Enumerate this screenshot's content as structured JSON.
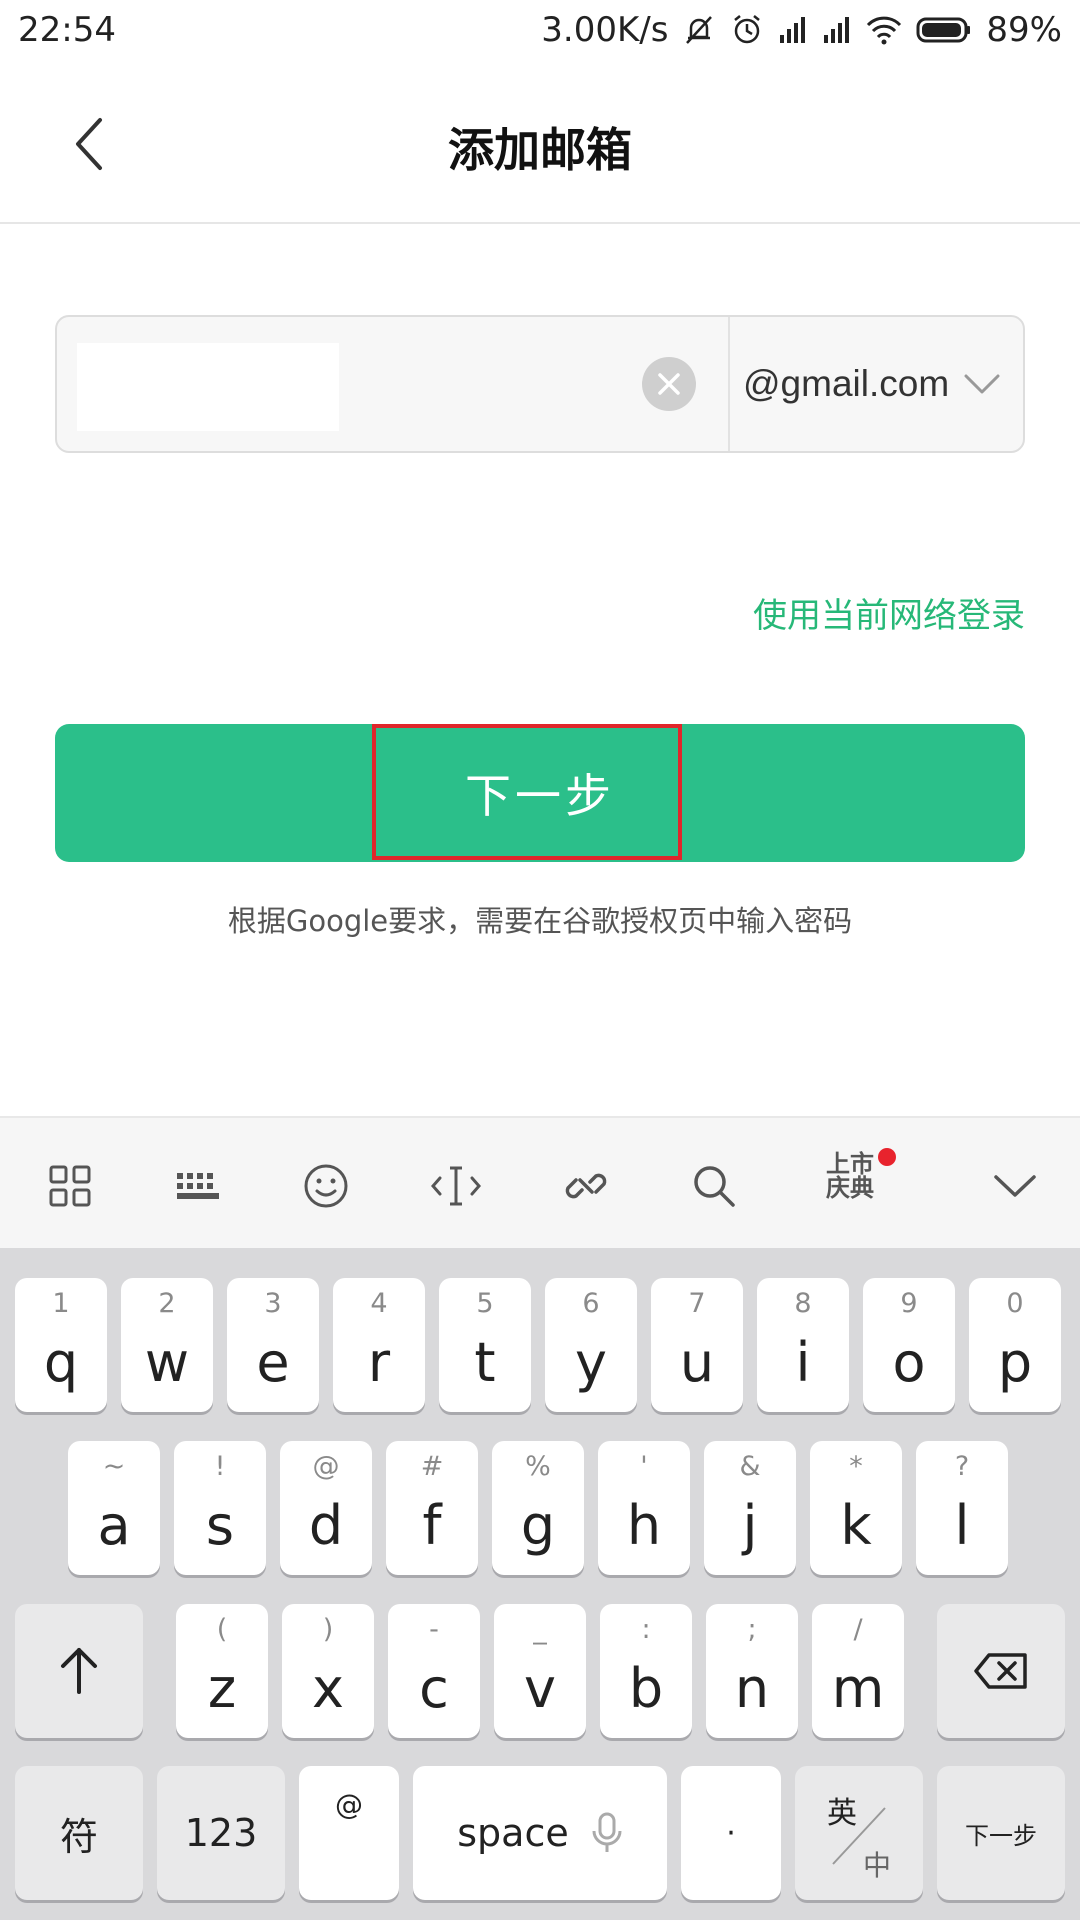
{
  "status": {
    "time": "22:54",
    "net_speed": "3.00K/s",
    "battery": "89%"
  },
  "header": {
    "title": "添加邮箱"
  },
  "email": {
    "value": "",
    "domain": "@gmail.com"
  },
  "links": {
    "network_login": "使用当前网络登录"
  },
  "primary_button": {
    "label": "下一步"
  },
  "hint_text": "根据Google要求，需要在谷歌授权页中输入密码",
  "keyboard": {
    "event_badge": "上市\n庆典",
    "row1": [
      {
        "hint": "1",
        "char": "q"
      },
      {
        "hint": "2",
        "char": "w"
      },
      {
        "hint": "3",
        "char": "e"
      },
      {
        "hint": "4",
        "char": "r"
      },
      {
        "hint": "5",
        "char": "t"
      },
      {
        "hint": "6",
        "char": "y"
      },
      {
        "hint": "7",
        "char": "u"
      },
      {
        "hint": "8",
        "char": "i"
      },
      {
        "hint": "9",
        "char": "o"
      },
      {
        "hint": "0",
        "char": "p"
      }
    ],
    "row2": [
      {
        "hint": "~",
        "char": "a"
      },
      {
        "hint": "!",
        "char": "s"
      },
      {
        "hint": "@",
        "char": "d"
      },
      {
        "hint": "#",
        "char": "f"
      },
      {
        "hint": "%",
        "char": "g"
      },
      {
        "hint": "'",
        "char": "h"
      },
      {
        "hint": "&",
        "char": "j"
      },
      {
        "hint": "*",
        "char": "k"
      },
      {
        "hint": "?",
        "char": "l"
      }
    ],
    "row3": [
      {
        "hint": "(",
        "char": "z"
      },
      {
        "hint": ")",
        "char": "x"
      },
      {
        "hint": "-",
        "char": "c"
      },
      {
        "hint": "_",
        "char": "v"
      },
      {
        "hint": ":",
        "char": "b"
      },
      {
        "hint": ";",
        "char": "n"
      },
      {
        "hint": "/",
        "char": "m"
      }
    ],
    "symbols_label": "符",
    "numbers_label": "123",
    "at_label": "@",
    "space_label": "space",
    "period_label": "·",
    "lang_top": "英",
    "lang_bottom": "中",
    "enter_label": "下一步"
  }
}
